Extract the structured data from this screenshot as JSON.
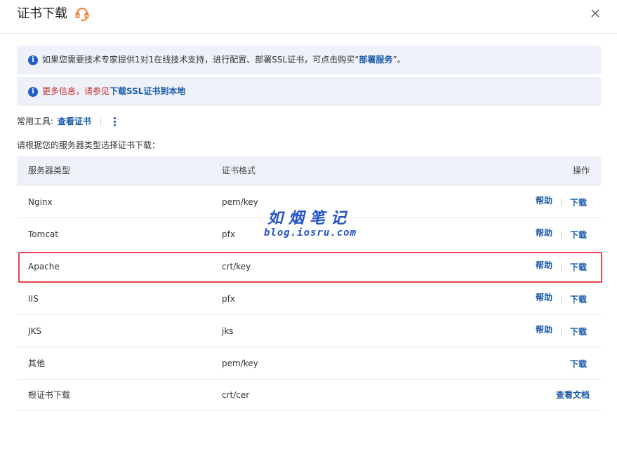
{
  "dialog": {
    "title": "证书下载",
    "support_icon": "headset-support-icon",
    "close_icon": "close-icon"
  },
  "alerts": [
    {
      "icon": "info-icon",
      "text": "如果您需要技术专家提供1对1在线技术支持，进行配置、部署SSL证书，可点击购买“",
      "link": "部署服务",
      "suffix": "”。"
    },
    {
      "icon": "info-icon",
      "text": "更多信息，请参见",
      "link": "下载SSL证书到本地",
      "suffix": ""
    }
  ],
  "tools": {
    "label": "常用工具:",
    "link": "查看证书",
    "more_icon": "more-vertical-icon"
  },
  "prompt": "请根据您的服务器类型选择证书下载：",
  "table": {
    "headers": {
      "type": "服务器类型",
      "format": "证书格式",
      "action": "操作"
    },
    "rows": [
      {
        "type": "Nginx",
        "format": "pem/key",
        "help": "帮助",
        "download": "下载"
      },
      {
        "type": "Tomcat",
        "format": "pfx",
        "help": "帮助",
        "download": "下载"
      },
      {
        "type": "Apache",
        "format": "crt/key",
        "help": "帮助",
        "download": "下载"
      },
      {
        "type": "IIS",
        "format": "pfx",
        "help": "帮助",
        "download": "下载"
      },
      {
        "type": "JKS",
        "format": "jks",
        "help": "帮助",
        "download": "下载"
      },
      {
        "type": "其他",
        "format": "pem/key",
        "download": "下载"
      },
      {
        "type": "根证书下载",
        "format": "crt/cer",
        "docs": "查看文档"
      }
    ]
  },
  "watermark": {
    "title": "如烟笔记",
    "url": "blog.iosru.com"
  },
  "colors": {
    "link": "#1a5aa8",
    "alert_bg": "#eef2f8",
    "warning_text": "#c3272b",
    "highlight_border": "#e8454f"
  }
}
